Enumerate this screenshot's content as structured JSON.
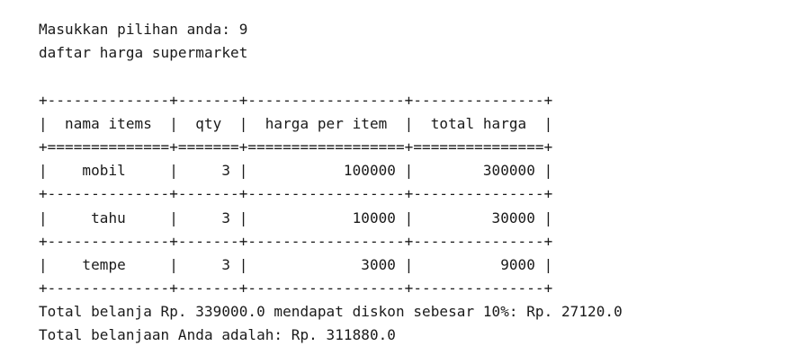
{
  "prompt_line": "Masukkan pilihan anda: 9",
  "heading": "daftar harga supermarket",
  "table": {
    "border_top": "+--------------+-------+------------------+---------------+",
    "header_row": "|  nama items  |  qty  |  harga per item  |  total harga  |",
    "header_sep": "+==============+=======+==================+===============+",
    "row_sep": "+--------------+-------+------------------+---------------+",
    "rows": [
      "|    mobil     |     3 |           100000 |        300000 |",
      "|     tahu     |     3 |            10000 |         30000 |",
      "|    tempe     |     3 |             3000 |          9000 |"
    ],
    "border_bottom": "+--------------+-------+------------------+---------------+"
  },
  "summary_line": "Total belanja Rp. 339000.0 mendapat diskon sebesar 10%: Rp. 27120.0",
  "total_line": "Total belanjaan Anda adalah: Rp. 311880.0"
}
